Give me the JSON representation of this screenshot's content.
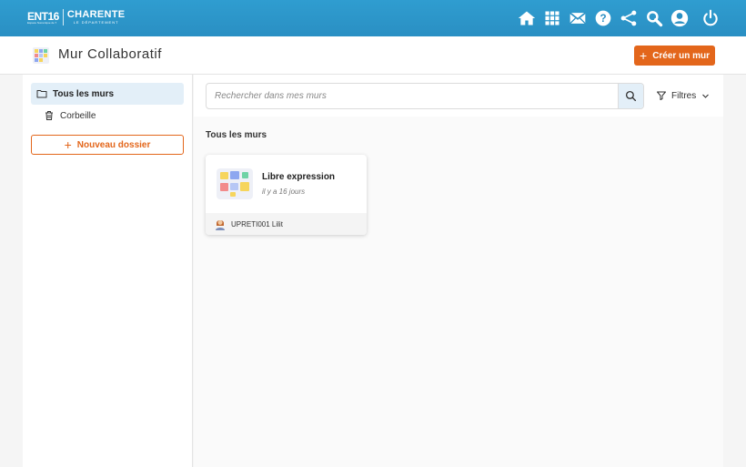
{
  "topbar": {
    "logo_ent": "ENT16",
    "logo_ent_sub": "Espace Numérique de Travail · Charente",
    "logo_charente": "CHARENTE",
    "logo_dept": "LE DÉPARTEMENT",
    "icons": [
      "home-icon",
      "apps-grid-icon",
      "mail-icon",
      "help-icon",
      "share-network-icon",
      "search-icon",
      "user-account-icon",
      "power-icon"
    ]
  },
  "app": {
    "title": "Mur Collaboratif",
    "create_button": "Créer un mur"
  },
  "sidebar": {
    "items": [
      {
        "label": "Tous les murs",
        "icon": "folder-icon",
        "active": true
      },
      {
        "label": "Corbeille",
        "icon": "trash-icon",
        "active": false
      }
    ],
    "new_folder_button": "Nouveau dossier"
  },
  "search": {
    "placeholder": "Rechercher dans mes murs",
    "value": ""
  },
  "filters": {
    "label": "Filtres"
  },
  "main": {
    "section_title": "Tous les murs",
    "cards": [
      {
        "title": "Libre expression",
        "date": "il y a 16 jours",
        "owner": "UPRETI001 Lilit"
      }
    ]
  },
  "colors": {
    "topbar": "#2f9dd0",
    "accent": "#e3661b",
    "active_bg": "#e3eff8"
  }
}
